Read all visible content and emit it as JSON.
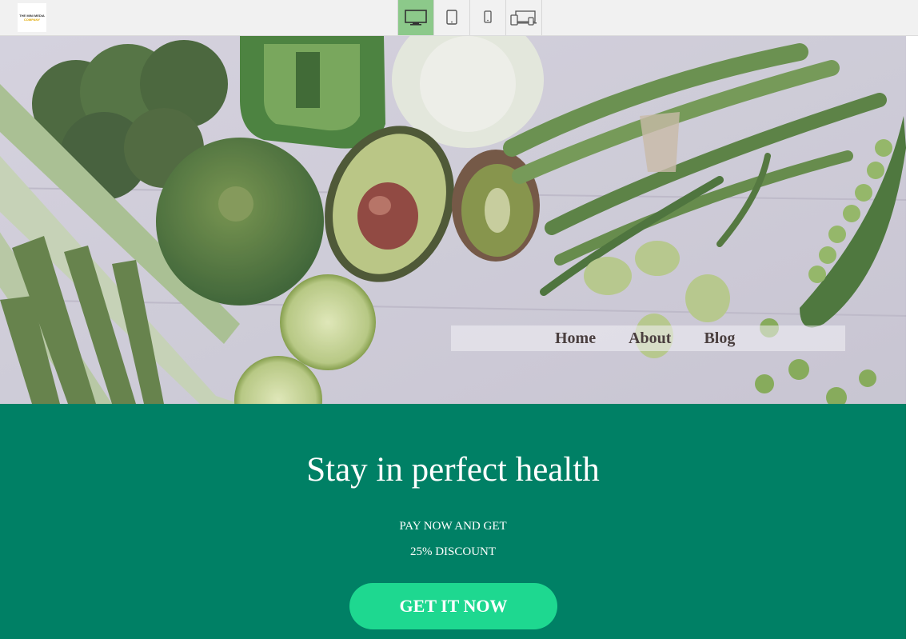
{
  "toolbar": {
    "logo_line1": "THE MINI MEDIA",
    "logo_line2": "COMPANY",
    "devices": [
      {
        "name": "desktop-icon",
        "active": true
      },
      {
        "name": "tablet-icon",
        "active": false
      },
      {
        "name": "phone-icon",
        "active": false
      },
      {
        "name": "responsive-icon",
        "active": false
      }
    ]
  },
  "hero": {
    "nav": [
      "Home",
      "About",
      "Blog"
    ]
  },
  "promo": {
    "headline": "Stay in perfect health",
    "line1": "PAY NOW AND GET",
    "line2": "25% DISCOUNT",
    "cta_label": "GET IT NOW"
  },
  "colors": {
    "toolbar_bg": "#f1f1f1",
    "active_device": "#8cc98a",
    "promo_bg": "#008065",
    "cta_bg": "#1ed890",
    "nav_text": "#4a3f3f"
  }
}
